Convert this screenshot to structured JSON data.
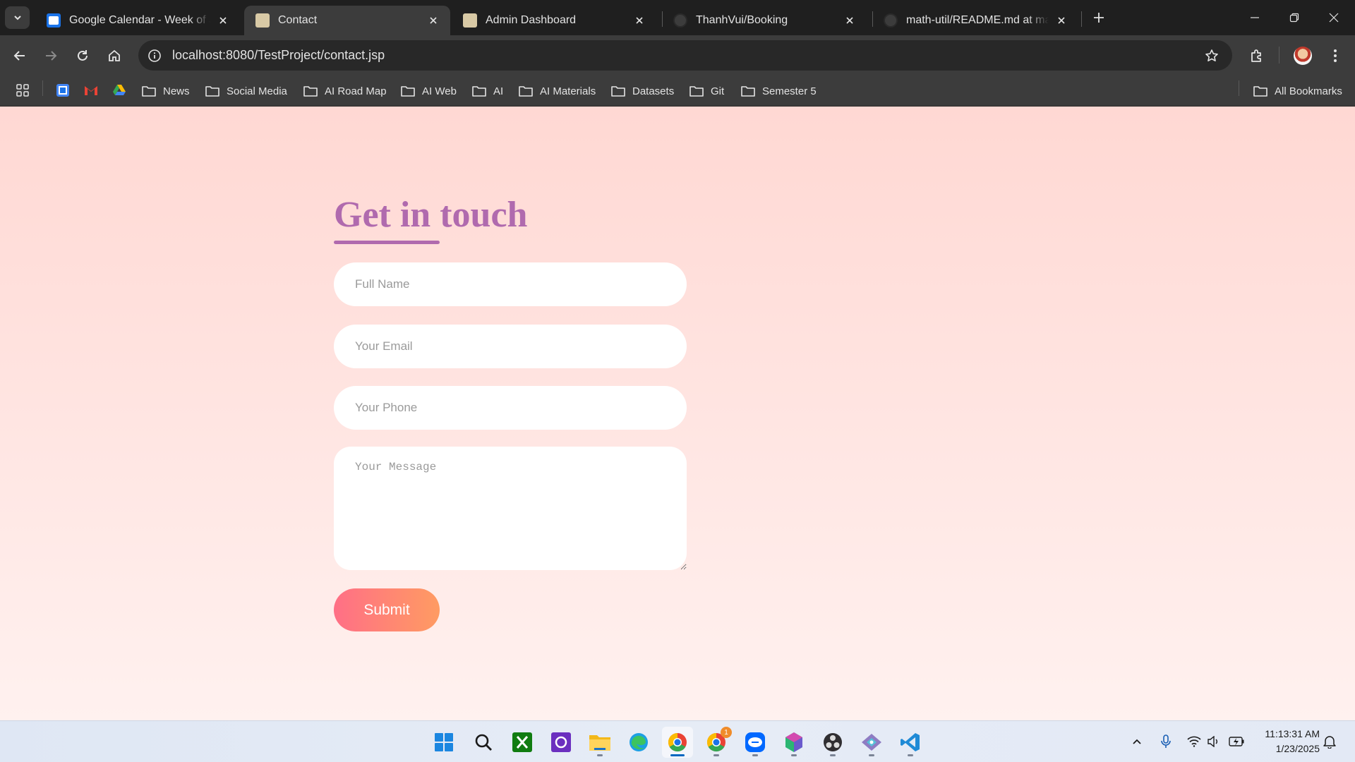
{
  "browser": {
    "tabs": [
      {
        "title": "Google Calendar - Week of January",
        "favicon": "calendar-icon",
        "active": false
      },
      {
        "title": "Contact",
        "favicon": "page-icon",
        "active": true
      },
      {
        "title": "Admin Dashboard",
        "favicon": "page-icon",
        "active": false
      },
      {
        "title": "ThanhVui/Booking",
        "favicon": "github-icon",
        "active": false
      },
      {
        "title": "math-util/README.md at main",
        "favicon": "github-icon",
        "active": false
      }
    ],
    "address": "localhost:8080/TestProject/contact.jsp",
    "bookmarks": [
      {
        "label": "News"
      },
      {
        "label": "Social Media"
      },
      {
        "label": "AI Road Map"
      },
      {
        "label": "AI Web"
      },
      {
        "label": "AI"
      },
      {
        "label": "AI Materials"
      },
      {
        "label": "Datasets"
      },
      {
        "label": "Git"
      },
      {
        "label": "Semester 5"
      }
    ],
    "all_bookmarks": "All Bookmarks"
  },
  "contact": {
    "heading": "Get in touch",
    "name_placeholder": "Full Name",
    "email_placeholder": "Your Email",
    "phone_placeholder": "Your Phone",
    "message_placeholder": "Your Message",
    "submit_label": "Submit"
  },
  "taskbar": {
    "apps": [
      "start-icon",
      "search-icon",
      "xbox-icon",
      "app-icon",
      "file-explorer-icon",
      "edge-icon",
      "chrome-icon",
      "chrome-profile-icon",
      "zalo-icon",
      "hex-app-icon",
      "obs-icon",
      "git-app-icon",
      "vscode-icon"
    ],
    "badge": "1",
    "time": "11:13:31 AM",
    "date": "1/23/2025"
  },
  "colors": {
    "accent": "#b06aae",
    "button_start": "#ff6f86",
    "button_end": "#ff9b62",
    "page_background": "#ffd8d3"
  }
}
